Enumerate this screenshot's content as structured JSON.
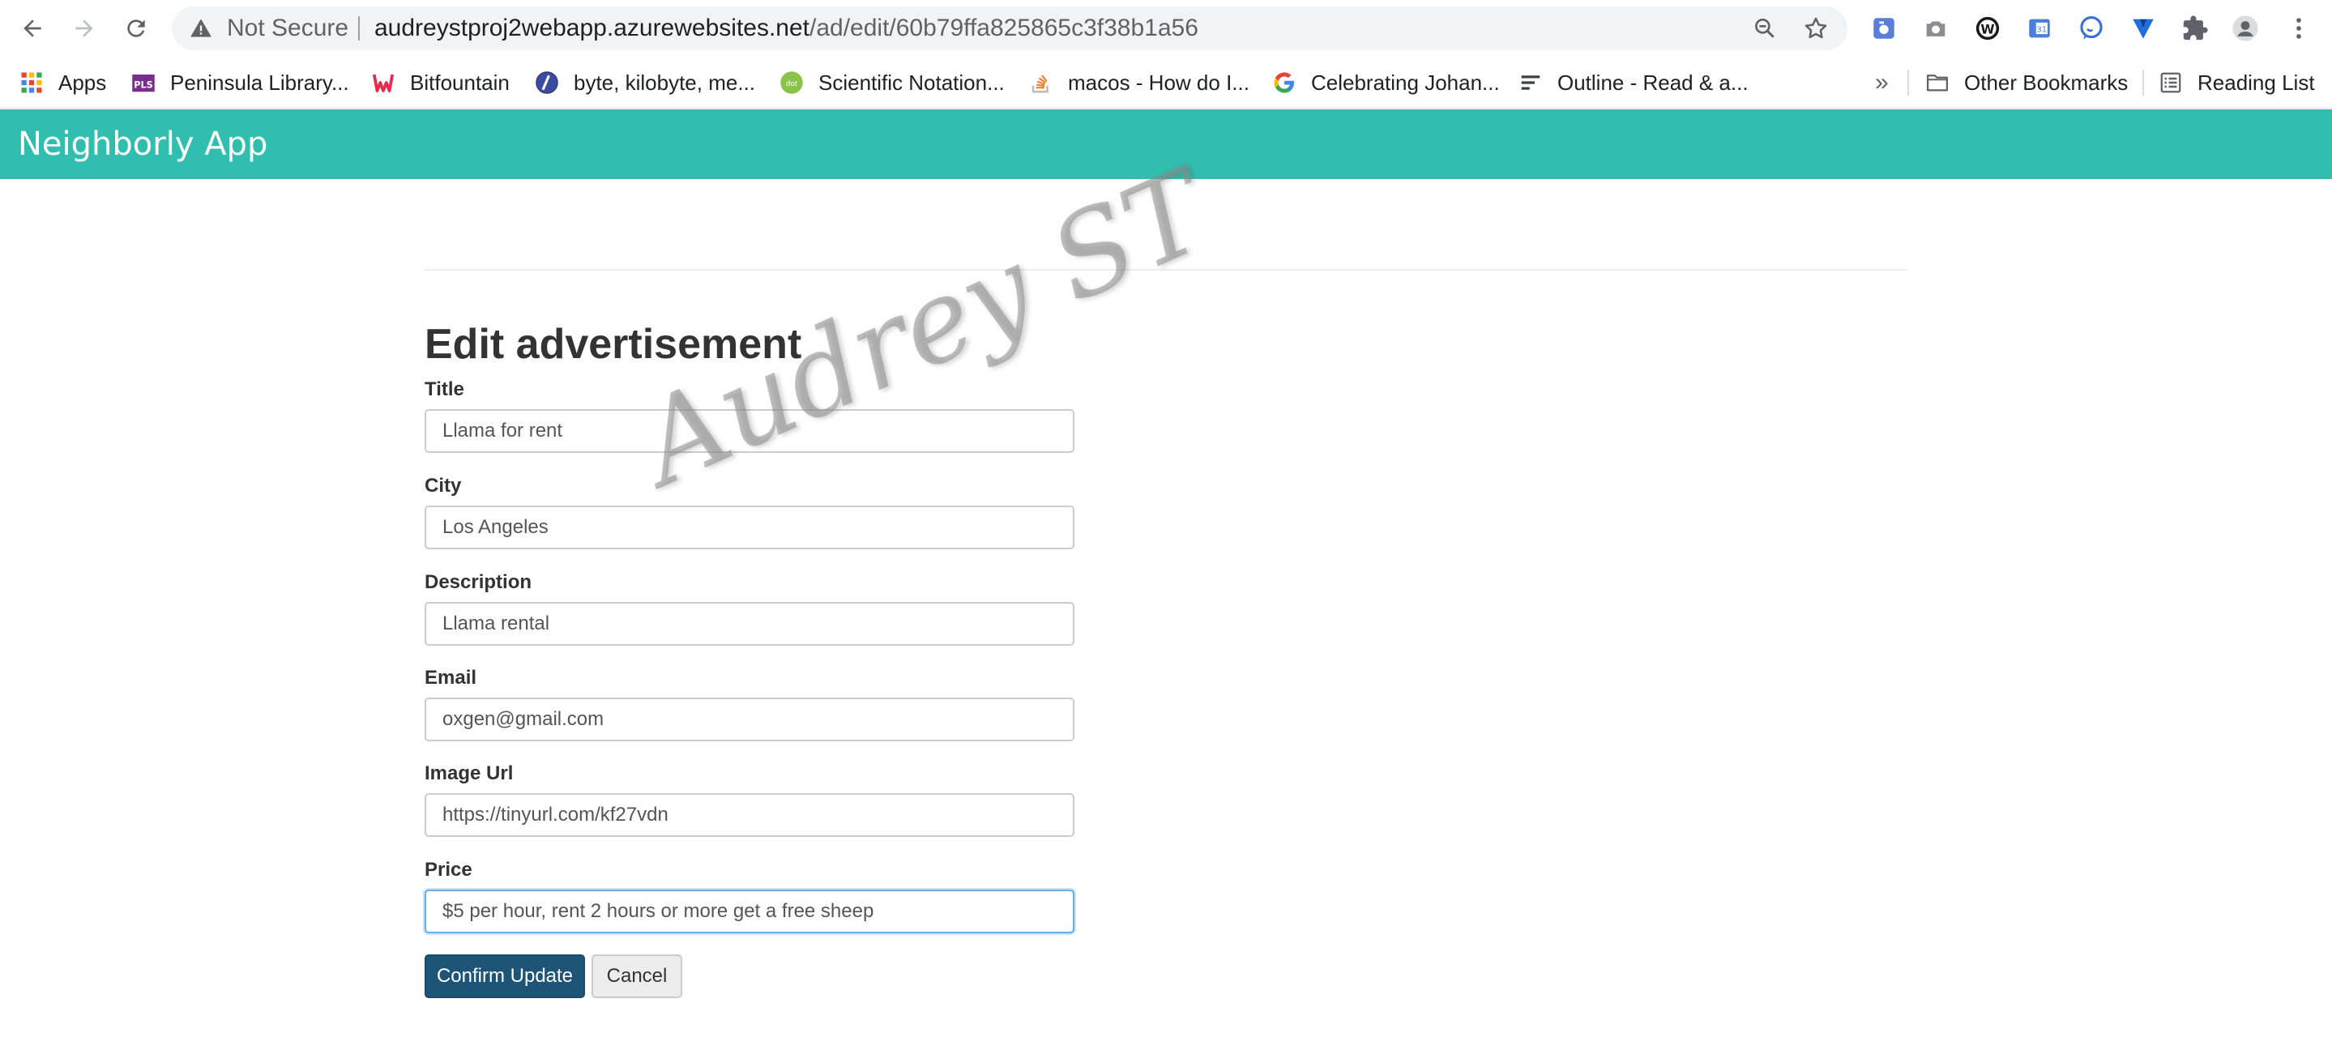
{
  "browser": {
    "not_secure": "Not Secure",
    "url_host": "audreystproj2webapp.azurewebsites.net",
    "url_path": "/ad/edit/60b79ffa825865c3f38b1a56",
    "extension_icons": [
      "camera-extension-icon",
      "screenshot-icon",
      "w-extension-icon",
      "calendar-extension-icon",
      "chat-extension-icon",
      "v-extension-icon",
      "puzzle-icon",
      "profile-icon",
      "more-vert-icon"
    ]
  },
  "bookmarks": {
    "items": [
      {
        "label": "Apps",
        "icon": "apps-grid-icon"
      },
      {
        "label": "Peninsula Library...",
        "icon": "pls-icon"
      },
      {
        "label": "Bitfountain",
        "icon": "bitfountain-icon"
      },
      {
        "label": "byte, kilobyte, me...",
        "icon": "byte-site-icon"
      },
      {
        "label": "Scientific Notation...",
        "icon": "dot-site-icon"
      },
      {
        "label": "macos - How do I...",
        "icon": "stackoverflow-icon"
      },
      {
        "label": "Celebrating Johan...",
        "icon": "google-icon"
      },
      {
        "label": "Outline - Read & a...",
        "icon": "outline-icon"
      }
    ],
    "overflow": "»",
    "other": "Other Bookmarks",
    "reading_list": "Reading List"
  },
  "app": {
    "brand": "Neighborly App"
  },
  "form": {
    "heading": "Edit advertisement",
    "fields": [
      {
        "label": "Title",
        "value": "Llama for rent"
      },
      {
        "label": "City",
        "value": "Los Angeles"
      },
      {
        "label": "Description",
        "value": "Llama rental"
      },
      {
        "label": "Email",
        "value": "oxgen@gmail.com"
      },
      {
        "label": "Image Url",
        "value": "https://tinyurl.com/kf27vdn"
      },
      {
        "label": "Price",
        "value": "$5 per hour, rent 2 hours or more get a free sheep"
      }
    ],
    "confirm_label": "Confirm Update",
    "cancel_label": "Cancel"
  },
  "watermark": "Audrey ST",
  "colors": {
    "navbar": "#30bfae",
    "primary_button": "#1f5479",
    "focus_border": "#66afe9"
  }
}
